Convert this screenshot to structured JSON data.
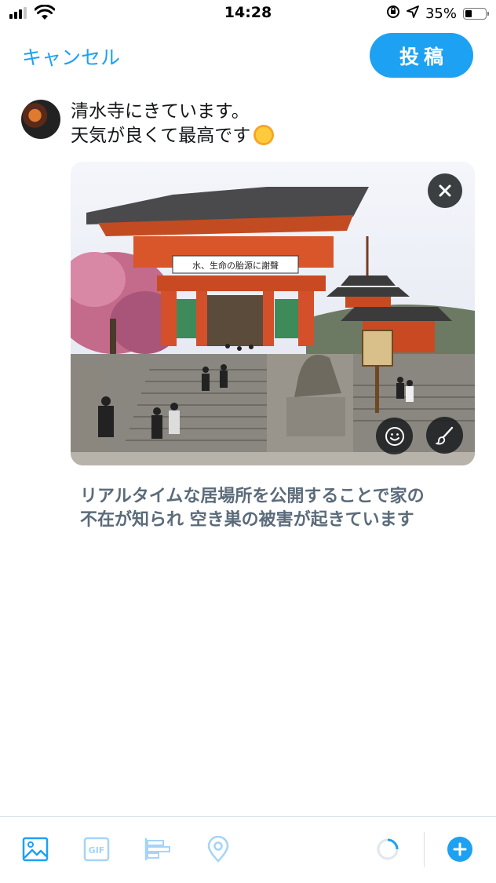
{
  "status_bar": {
    "time": "14:28",
    "battery_percent": "35%",
    "battery_level": 0.35
  },
  "header": {
    "cancel_label": "キャンセル",
    "post_label": "投稿"
  },
  "composer": {
    "text_lines": [
      "清水寺にきています。",
      "天気が良くて最高です"
    ],
    "emoji": "sun-with-face"
  },
  "warning": {
    "lines": [
      "リアルタイムな居場所を公開することで家の",
      "不在が知られ 空き巣の被害が起きています"
    ]
  },
  "photo_sign": {
    "banner": "水、生命の胎源に謝聲"
  },
  "toolbar": {
    "icons": [
      "image-icon",
      "gif-icon",
      "poll-icon",
      "location-icon",
      "character-count-ring",
      "add-thread-icon"
    ],
    "gif_label": "GIF"
  },
  "colors": {
    "accent": "#1da1f2",
    "warning_text": "#5b6b7a",
    "icon_faded": "#a5d4f8"
  }
}
